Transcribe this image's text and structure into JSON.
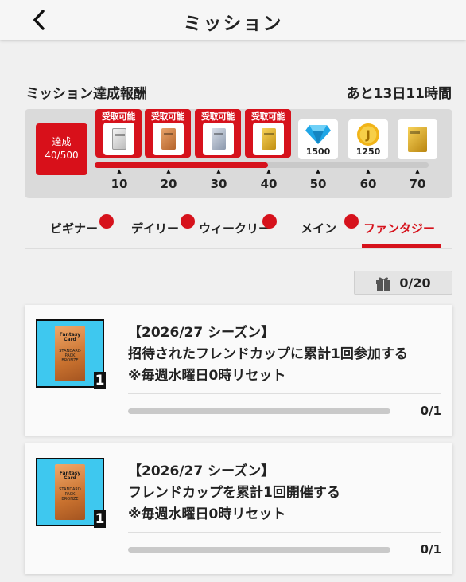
{
  "header": {
    "title": "ミッション",
    "back_icon": "chevron-left-icon"
  },
  "rewards": {
    "title": "ミッション達成報酬",
    "time_left": "あと13日11時間",
    "achieve_label": "達成",
    "achieve_count": "40/500",
    "progress_fraction": 0.52,
    "claim_label": "受取可能",
    "milestones": [
      {
        "level": "10",
        "claimable": true,
        "reward": "silver-pack"
      },
      {
        "level": "20",
        "claimable": true,
        "reward": "bronze-pack"
      },
      {
        "level": "30",
        "claimable": true,
        "reward": "silver-blue-pack"
      },
      {
        "level": "40",
        "claimable": true,
        "reward": "gold-pack"
      },
      {
        "level": "50",
        "claimable": false,
        "reward": "diamond-gem",
        "amount": "1500"
      },
      {
        "level": "60",
        "claimable": false,
        "reward": "j-coin",
        "amount": "1250"
      },
      {
        "level": "70",
        "claimable": false,
        "reward": "gold-pack"
      }
    ]
  },
  "tabs": [
    {
      "label": "ビギナー",
      "badge": true,
      "active": false
    },
    {
      "label": "デイリー",
      "badge": true,
      "active": false
    },
    {
      "label": "ウィークリー",
      "badge": true,
      "active": false
    },
    {
      "label": "メイン",
      "badge": true,
      "active": false
    },
    {
      "label": "ファンタジー",
      "badge": false,
      "active": true
    }
  ],
  "counter": {
    "icon": "gift-icon",
    "value": "0/20"
  },
  "pack_art": {
    "brand": "Fantasy Card",
    "line1": "STANDARD PACK",
    "line2": "BRONZE"
  },
  "missions": [
    {
      "season": "【2026/27 シーズン】",
      "description": "招待されたフレンドカップに累計1回参加する",
      "note": "※毎週水曜日0時リセット",
      "progress": "0/1",
      "progress_fraction": 0,
      "quantity": "1"
    },
    {
      "season": "【2026/27 シーズン】",
      "description": "フレンドカップを累計1回開催する",
      "note": "※毎週水曜日0時リセット",
      "progress": "0/1",
      "progress_fraction": 0,
      "quantity": "1"
    }
  ],
  "colors": {
    "accent": "#d6121c",
    "diamond": "#1fa6e6",
    "coin": "#f1b418"
  }
}
